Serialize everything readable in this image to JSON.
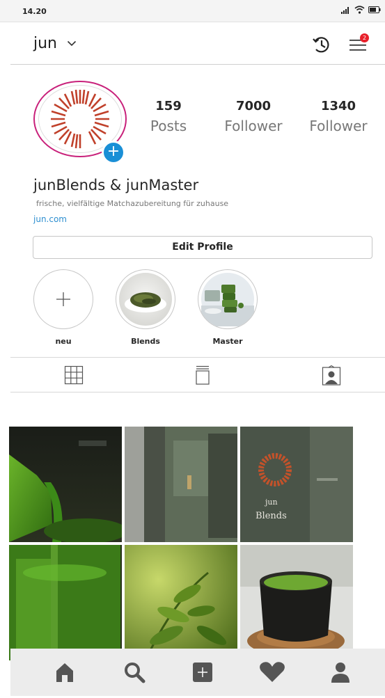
{
  "status_bar": {
    "time": "14.20"
  },
  "header": {
    "username": "jun",
    "notification_count": "2"
  },
  "profile": {
    "stats": [
      {
        "count": "159",
        "label": "Posts"
      },
      {
        "count": "7000",
        "label": "Follower"
      },
      {
        "count": "1340",
        "label": "Follower"
      }
    ],
    "name": "junBlends & junMaster",
    "bio": "frische, vielfältige Matchazubereitung für zuhause",
    "link": "jun.com",
    "edit_button": "Edit Profile"
  },
  "highlights": [
    {
      "label": "neu"
    },
    {
      "label": "Blends"
    },
    {
      "label": "Master"
    }
  ],
  "tabs": [
    "grid-icon",
    "igtv-icon",
    "tagged-icon"
  ],
  "posts": [
    {
      "overlay_text": ""
    },
    {
      "overlay_text": ""
    },
    {
      "overlay_text": "jun\nBlends"
    },
    {
      "overlay_text": ""
    },
    {
      "overlay_text": ""
    },
    {
      "overlay_text": ""
    }
  ],
  "bottom_nav": [
    "home-icon",
    "search-icon",
    "add-post-icon",
    "heart-icon",
    "profile-icon"
  ],
  "colors": {
    "accent_blue": "#1a8fd6",
    "story_ring": "#c8207a",
    "badge_red": "#e8202a",
    "logo_red": "#c0402a",
    "link_blue": "#2e8fd0"
  }
}
